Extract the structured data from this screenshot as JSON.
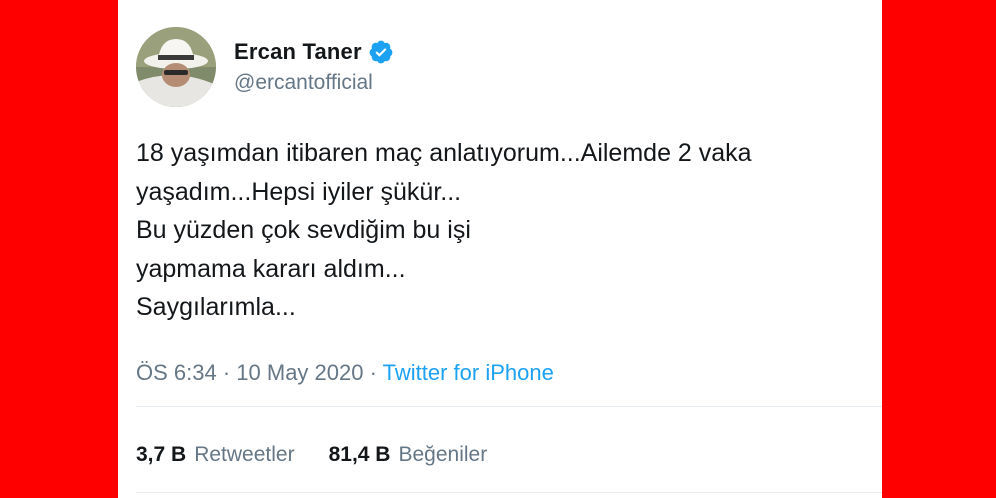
{
  "colors": {
    "background": "#ff0000",
    "card": "#ffffff",
    "text": "#14171a",
    "muted": "#657786",
    "link": "#1da1f2",
    "verified": "#1da1f2"
  },
  "user": {
    "display_name": "Ercan Taner",
    "handle": "@ercantofficial",
    "verified_icon": "verified-badge-icon",
    "avatar_icon": "avatar-photo"
  },
  "tweet": {
    "lines": [
      "18 yaşımdan itibaren maç anlatıyorum...Ailemde 2 vaka",
      "yaşadım...Hepsi iyiler şükür...",
      "Bu yüzden çok sevdiğim bu işi",
      "yapmama kararı aldım...",
      "Saygılarımla..."
    ]
  },
  "meta": {
    "time": "ÖS 6:34",
    "separator": " · ",
    "date": "10 May 2020",
    "source": "Twitter for iPhone"
  },
  "stats": {
    "retweets_count": "3,7 B",
    "retweets_label": "Retweetler",
    "likes_count": "81,4 B",
    "likes_label": "Beğeniler"
  }
}
